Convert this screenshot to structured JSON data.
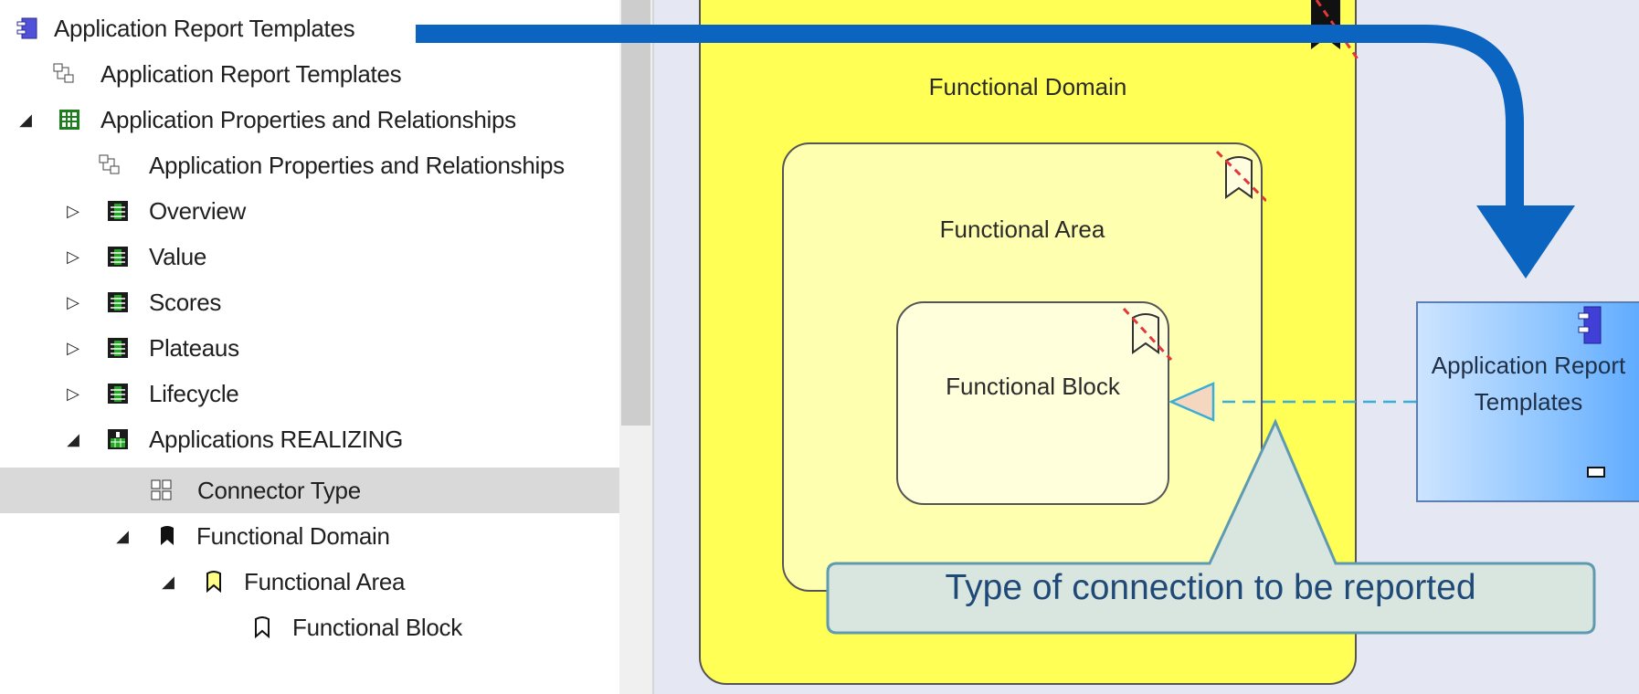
{
  "tree": {
    "items": [
      {
        "label": "Application Report Templates"
      },
      {
        "label": "Application Report Templates"
      },
      {
        "label": "Application Properties and Relationships"
      },
      {
        "label": "Application Properties and Relationships"
      },
      {
        "label": "Overview"
      },
      {
        "label": "Value"
      },
      {
        "label": "Scores"
      },
      {
        "label": "Plateaus"
      },
      {
        "label": "Lifecycle"
      },
      {
        "label": "Applications REALIZING"
      },
      {
        "label": "Connector Type"
      },
      {
        "label": "Functional Domain"
      },
      {
        "label": "Functional Area"
      },
      {
        "label": "Functional Block"
      }
    ]
  },
  "diagram": {
    "domain_label": "Functional Domain",
    "area_label": "Functional Area",
    "block_label": "Functional Block",
    "app_label_line1": "Application Report",
    "app_label_line2": "Templates",
    "callout": "Type of connection to be reported"
  },
  "colors": {
    "selection": "#d9d9d9",
    "domain_fill": "#ffff55",
    "area_fill": "#ffffb0",
    "block_fill": "#ffffdb",
    "app_fill": "#8fc6ff",
    "arrow_blue": "#0b64c0",
    "connector": "#3aaed6",
    "callout_fill": "#d9e6e0"
  }
}
